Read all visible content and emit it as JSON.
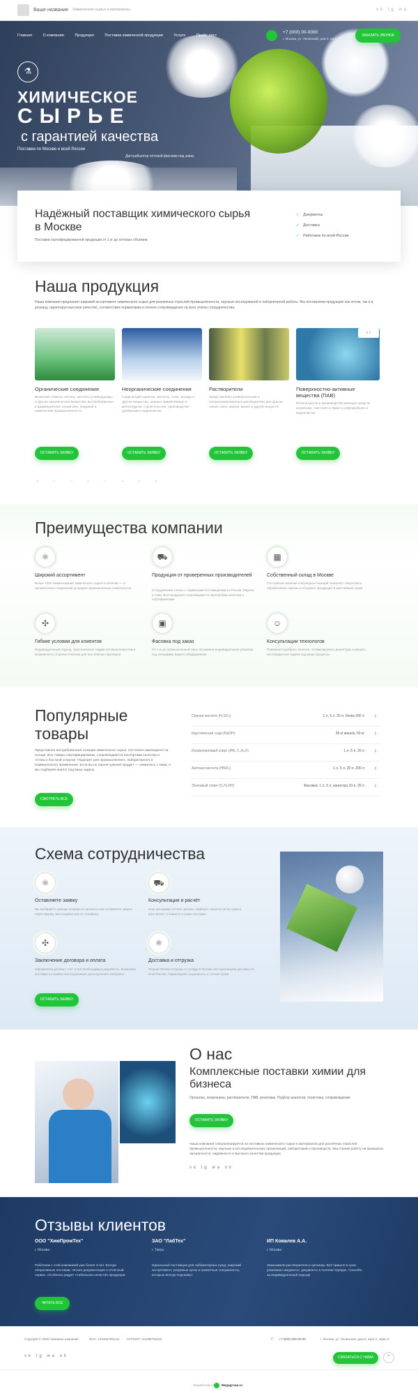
{
  "top": {
    "site": "Ваше название",
    "tagline": "Химическое сырье и материалы",
    "icons": "vk tg wa"
  },
  "nav": [
    "Главная",
    "О компании",
    "Продукция",
    "Поставка химической продукции",
    "Услуги",
    "Прайс-лист"
  ],
  "contact": {
    "phone": "+7 (000) 00-0000",
    "address": "г. Москва, ул. Ленинский, дом 0, корп 0, оф. 0",
    "call_btn": "ЗАКАЗАТЬ ЗВОНОК"
  },
  "hero": {
    "l1": "ХИМИЧЕСКОЕ",
    "l2": "СЫРЬЕ",
    "l3": "с гарантией качества",
    "sub": "Поставки по Москве и всей России",
    "sub2": "Дистрибьютер оптовой фасовки под заказ"
  },
  "card": {
    "title": "Надёжный поставщик химического сырья в Москве",
    "sub": "Поставки сертифицированной продукции от 1 кг до оптовых объёмов",
    "features": [
      "Документы",
      "Доставка",
      "Работаем по всей России"
    ]
  },
  "products": {
    "title": "Наша продукция",
    "lead": "Наша компания предлагает широкий ассортимент химического сырья для различных отраслей промышленности, научных исследований и лабораторной работы. Мы поставляем продукцию как оптом, так и в розницу, гарантируя высокое качество, соответствие нормативам и полное сопровождение на всех этапах сотрудничества.",
    "arrows": "‹ ›",
    "btn": "ОСТАВИТЬ ЗАЯВКУ",
    "items": [
      {
        "t": "Органические соединения",
        "d": "Включают спирты, кетоны, кислоты углеводороды и другие органические вещества, востребованные в фармацевтике, косметике, пищевой и химической промышленности"
      },
      {
        "t": "Неорганические соединения",
        "d": "Сюда входят щелочи, кислоты, соли, оксиды и другие вещества, широко применяемые в металлургии, строительстве, производстве удобрений и водоочистке"
      },
      {
        "t": "Растворители",
        "d": "Представлены универсальные и специализированные растворители для красок, лаков, смол, жиров, масел и других веществ"
      },
      {
        "t": "Поверхностно-активные вещества (ПАВ)",
        "d": "Используются в производстве моющих средств косметики, текстиля а также в нефтедобыче и водоочистке"
      }
    ]
  },
  "advantages": {
    "title": "Преимущества компании",
    "items": [
      {
        "t": "Широкий ассортимент",
        "d": "Более 1000 наименований химического сырья в наличии — от органических соединений до редких промышленных компонентов"
      },
      {
        "t": "Продукция от проверенных производителей",
        "d": "Сотрудничаем только с надёжными поставщиками из России, Европы и Азии. Вся продукция сопровождается паспортами качества и сертификатами"
      },
      {
        "t": "Собственный склад в Москве",
        "d": "Постоянное наличие популярных позиций позволяет оперативно обрабатывать заказы и отгружать продукцию в кратчайшие сроки"
      },
      {
        "t": "Гибкие условия для клиентов",
        "d": "Индивидуальный подход, персональные скидки оптовым клиентам и возможность отсрочки платежа для постоянных партнёров"
      },
      {
        "t": "Фасовка под заказ",
        "d": "От 1 кг до промышленной тары. Возможна индивидуальная упаковка под специфику вашего оборудования"
      },
      {
        "t": "Консультации технологов",
        "d": "Поможем подобрать аналоги, оптимизировать рецептуры и решить нестандартные задачи под ваши процессы"
      }
    ]
  },
  "popular": {
    "t1": "Популярные",
    "t2": "товары",
    "lead": "Представлен востребованные позиции химического сырья, постоянно имеющиеся на складе. Все товары сертифицированы, сопровождаются паспортами качества и готовы к быстрой отгрузке. Подходят для промышленного, лабораторного и коммерческого применения. Если вы не нашли нужный продукт — свяжитесь с нами, и мы подберём аналог под вашу задачу.",
    "btn": "СМОТРЕТЬ ВСЕ",
    "rows": [
      {
        "n": "Серная кислота (H₂SO₄)",
        "p": "1 л, 5 л, 20 л, бочка 200 л"
      },
      {
        "n": "Каустическая сода (NaOH)",
        "p": "25 кг мешок, 50 кг"
      },
      {
        "n": "Изопропиловый спирт (IPA, C₃H₈O)",
        "p": "1 л, 5 л, 20 л"
      },
      {
        "n": "Азотная кислота (HNO₃)",
        "p": "1 л, 5 л, 20 л, 200 л"
      },
      {
        "n": "Этиловый спирт (C₂H₅OH)",
        "p": "Фасовка: 1 л, 5 л, канистра 10 л, 20 л"
      }
    ]
  },
  "scheme": {
    "title": "Схема сотрудничества",
    "btn": "ОСТАВИТЬ ЗАЯВКУ",
    "items": [
      {
        "t": "Оставляете заявку",
        "d": "Вы выбираете нужные позиции из каталога или оставляете запрос через форму, мессенджер или по телефону"
      },
      {
        "t": "Консультация и расчёт",
        "d": "Наш менеджер уточнит детали, подберёт аналоги (если нужно), рассчитает стоимость и сроки поставки"
      },
      {
        "t": "Заключение договора и оплата",
        "d": "Оформляем договор, счет и все необходимые документы. Возможна поставка по заявке или подписание долгосрочного контракта"
      },
      {
        "t": "Доставка и отгрузка",
        "d": "Осуществляем отгрузку со склада в Москве или организуем доставку по всей России. Гарантируем сохранность и точные сроки"
      }
    ]
  },
  "about": {
    "title": "О нас",
    "sub": "Комплексные поставки химии для бизнеса",
    "tags": "Органика, неорганика, растворители, ПАВ, реактивы. Подбор аналогов, логистика, сопровождение",
    "btn": "ОСТАВИТЬ ЗАЯВКУ",
    "text": "Наша компания специализируется на поставках химического сырья и материалов для различных отраслей промышленности, научных и исследовательских организаций, лабораторий и производств. Мы строим работу на принципах прозрачности, надёжности и высокого качества продукции",
    "icons": "vk tg wa ok"
  },
  "reviews": {
    "title": "Отзывы клиентов",
    "btn": "ЧИТАТЬ ВСЕ",
    "items": [
      {
        "t": "ООО \"ХимПромТех\"",
        "c": "г. Москва",
        "d": "Работаем с этой компанией уже более 3 лет. Всегда оперативные поставки, чёткая документация и отличный сервис. Особенно радует стабильное качество продукции"
      },
      {
        "t": "ЗАО \"ЛабТех\"",
        "c": "г. Тверь",
        "d": "Идеальный поставщик для лабораторных нужд: широкий ассортимент, разумные цены и грамотные специалисты, которые всегда подскажут"
      },
      {
        "t": "ИП Ковалев А.А.",
        "c": "г. Москва",
        "d": "Заказывали растворители и органику. Всё пришло в срок, упаковано аккуратно, документы в полном порядке. Спасибо за индивидуальный подход!"
      }
    ]
  },
  "footer": {
    "copy": "Copyright © 2025 Название компании",
    "inn": "ИНН: 1234567891111",
    "ogrn": "ОГРНИП: 111098765432",
    "phone": "+7 (000) 000-00-00",
    "addr": "г. Москва, ул. Ленинская, дом 0, корп 0, офис 0",
    "btn": "СВЯЗАТЬСЯ С НАМИ",
    "icons": "vk tg wa ok",
    "dev": "Разработано в",
    "dev_brand": "Megagroup.ru"
  }
}
